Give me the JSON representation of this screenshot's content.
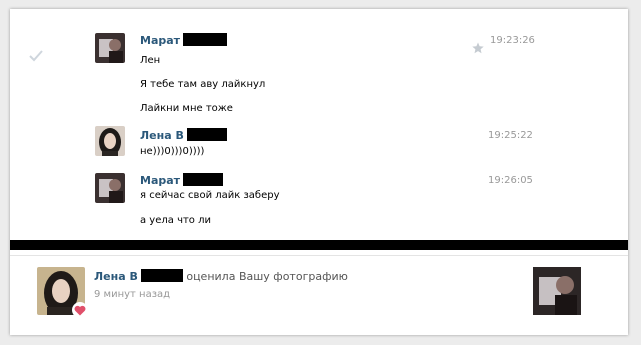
{
  "messages": [
    {
      "sender": "Марат",
      "time": "19:23:26",
      "lines": [
        "Лен",
        "Я тебе там аву лайкнул",
        "Лайкни мне тоже"
      ]
    },
    {
      "sender": "Лена В",
      "time": "19:25:22",
      "lines": [
        "не)))0)))0))))"
      ]
    },
    {
      "sender": "Марат",
      "time": "19:26:05",
      "lines": [
        "я сейчас свой лайк заберу",
        "а уела что ли"
      ]
    }
  ],
  "notification": {
    "name": "Лена В",
    "action": "оценила Вашу фотографию",
    "time": "9 минут назад"
  },
  "colors": {
    "link": "#2b587a",
    "muted": "#999999",
    "heart": "#e0506a"
  },
  "icons": [
    "check-icon",
    "star-icon",
    "heart-icon"
  ]
}
